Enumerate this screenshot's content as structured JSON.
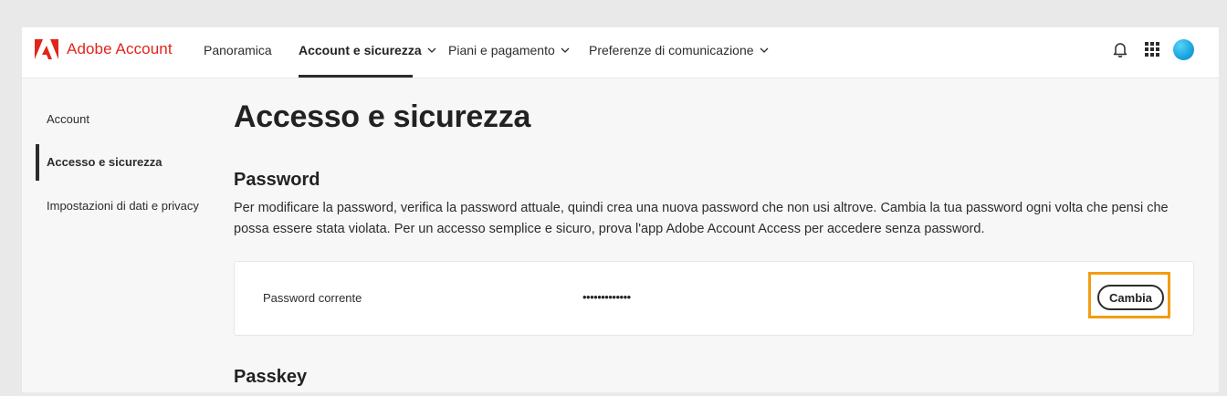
{
  "header": {
    "brand": "Adobe Account",
    "nav": [
      {
        "label": "Panoramica"
      },
      {
        "label": "Account e sicurezza"
      },
      {
        "label": "Piani e pagamento"
      },
      {
        "label": "Preferenze di comunicazione"
      }
    ],
    "icons": [
      "bell-icon",
      "apps-grid-icon",
      "avatar"
    ],
    "accent_color": "#e1251b"
  },
  "sidebar": {
    "items": [
      {
        "label": "Account"
      },
      {
        "label": "Accesso e sicurezza"
      },
      {
        "label": "Impostazioni di dati e privacy"
      }
    ]
  },
  "main": {
    "title": "Accesso e sicurezza",
    "password_section": {
      "title": "Password",
      "description": "Per modificare la password, verifica la password attuale, quindi crea una nuova password che non usi altrove. Cambia la tua password ogni volta che pensi che possa essere stata violata. Per un accesso semplice e sicuro, prova l'app Adobe Account Access per accedere senza password.",
      "row_label": "Password corrente",
      "row_value": "•••••••••••••",
      "change_button": "Cambia"
    },
    "passkey_section": {
      "title": "Passkey"
    }
  },
  "colors": {
    "highlight": "#f29d12",
    "avatar": "#1aa4e0"
  }
}
